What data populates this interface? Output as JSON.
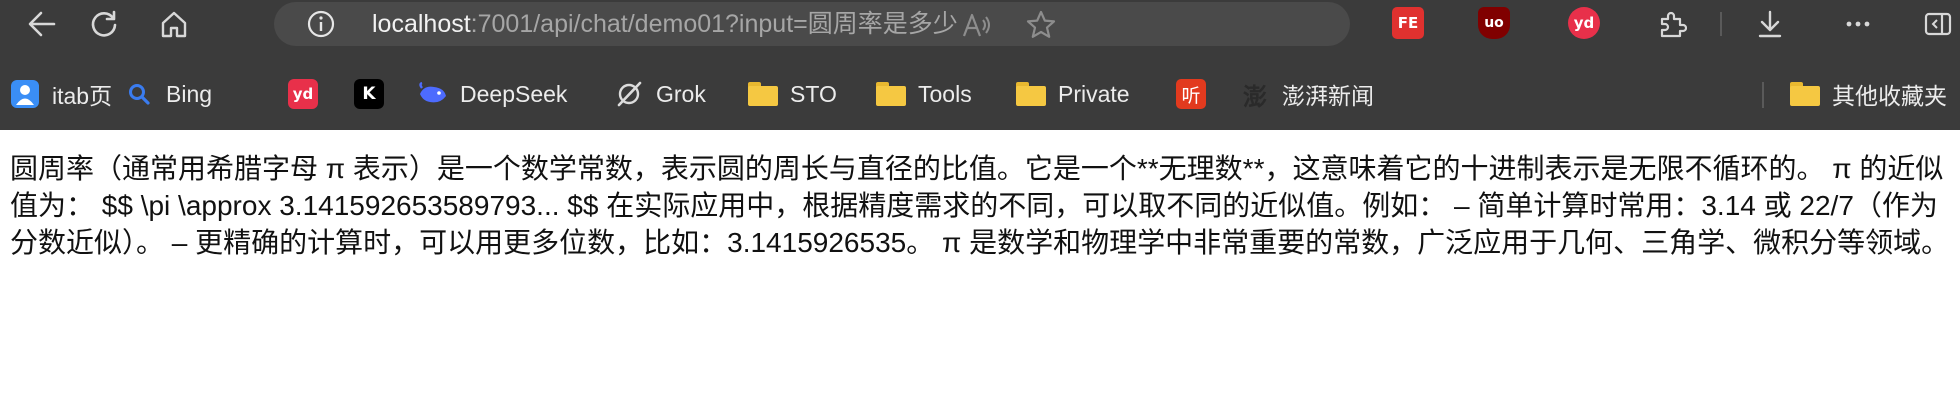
{
  "toolbar": {
    "address": {
      "host": "localhost",
      "path": ":7001/api/chat/demo01?input=圆周率是多少"
    },
    "extensions": [
      {
        "name": "fe-helper",
        "label": "FE",
        "color": "#e0312f"
      },
      {
        "name": "ublock",
        "label": "uo",
        "color": "#800000"
      },
      {
        "name": "youdao",
        "label": "yd",
        "color": "#e8304a"
      }
    ]
  },
  "bookmarks": {
    "items": [
      {
        "label": "itab页",
        "icon": "itab-icon"
      },
      {
        "label": "Bing",
        "icon": "bing-search-icon"
      },
      {
        "label": "",
        "icon": "youdao-icon"
      },
      {
        "label": "",
        "icon": "kimi-icon"
      },
      {
        "label": "DeepSeek",
        "icon": "deepseek-icon"
      },
      {
        "label": "Grok",
        "icon": "grok-icon"
      },
      {
        "label": "STO",
        "icon": "folder-icon"
      },
      {
        "label": "Tools",
        "icon": "folder-icon"
      },
      {
        "label": "Private",
        "icon": "folder-icon"
      },
      {
        "label": "",
        "icon": "ting-icon"
      },
      {
        "label": "澎湃新闻",
        "icon": "thepaper-icon"
      }
    ],
    "other": {
      "label": "其他收藏夹",
      "icon": "folder-icon"
    }
  },
  "page": {
    "text": "圆周率（通常用希腊字母 π 表示）是一个数学常数，表示圆的周长与直径的比值。它是一个**无理数**，这意味着它的十进制表示是无限不循环的。 π 的近似值为： $$ \\pi \\approx 3.141592653589793... $$ 在实际应用中，根据精度需求的不同，可以取不同的近似值。例如： – 简单计算时常用：3.14 或 22/7（作为分数近似）。 – 更精确的计算时，可以用更多位数，比如：3.1415926535。 π 是数学和物理学中非常重要的常数，广泛应用于几何、三角学、微积分等领域。"
  },
  "colors": {
    "chrome": "#3b3b3b",
    "address_bg": "#4a4a4a",
    "folder": "#f5c842"
  }
}
